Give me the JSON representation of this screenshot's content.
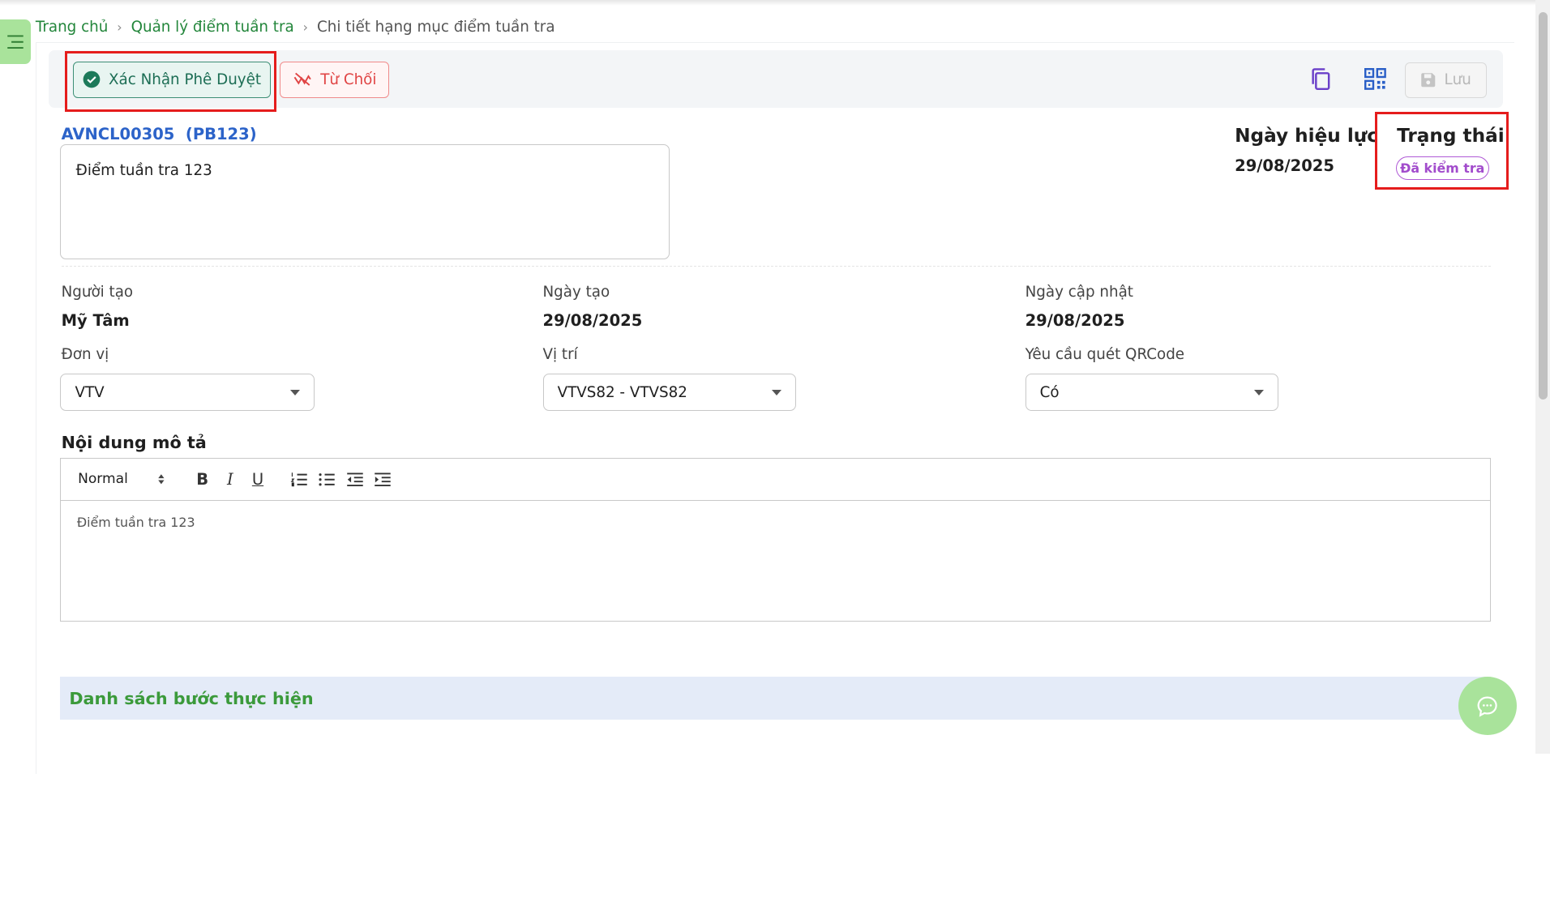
{
  "breadcrumb": {
    "home": "Trang chủ",
    "list": "Quản lý điểm tuần tra",
    "current": "Chi tiết hạng mục điểm tuần tra"
  },
  "toolbar": {
    "approve_label": "Xác Nhận Phê Duyệt",
    "reject_label": "Từ Chối",
    "save_label": "Lưu"
  },
  "record": {
    "code": "AVNCL00305  (PB123)",
    "name": "Điểm tuần tra 123",
    "effective_label": "Ngày hiệu lực",
    "effective_date": "29/08/2025",
    "status_label": "Trạng thái",
    "status_value": "Đã kiểm tra"
  },
  "fields": {
    "creator_label": "Người tạo",
    "creator_value": "Mỹ Tâm",
    "created_label": "Ngày tạo",
    "created_value": "29/08/2025",
    "updated_label": "Ngày cập nhật",
    "updated_value": "29/08/2025",
    "unit_label": "Đơn vị",
    "unit_value": "VTV",
    "location_label": "Vị trí",
    "location_value": "VTVS82 - VTVS82",
    "qr_label": "Yêu cầu quét QRCode",
    "qr_value": "Có"
  },
  "description": {
    "title": "Nội dung mô tả",
    "format": "Normal",
    "bold": "B",
    "italic": "I",
    "underline": "U",
    "content": "Điểm tuần tra 123"
  },
  "steps": {
    "title": "Danh sách bước thực hiện"
  },
  "colors": {
    "primary_green": "#23863b",
    "approve_border": "#3d8f76",
    "reject_red": "#e04545",
    "status_purple": "#a24ccc",
    "highlight_red": "#e51c1c"
  }
}
